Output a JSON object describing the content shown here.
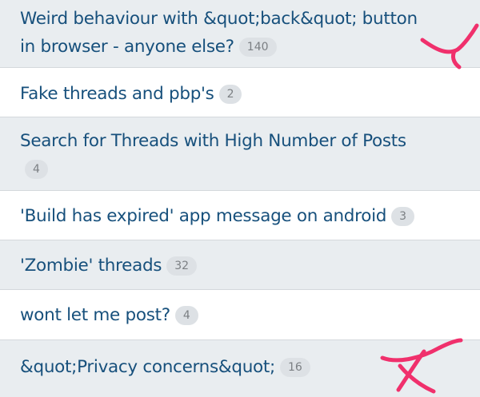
{
  "threads": [
    {
      "title": "Weird behaviour with &quot;back&quot; button in browser - anyone else?",
      "count": "140"
    },
    {
      "title": "Fake threads and pbp's",
      "count": "2"
    },
    {
      "title": "Search for Threads with High Number of Posts",
      "count": "4"
    },
    {
      "title": "'Build has expired' app message on android",
      "count": "3"
    },
    {
      "title": "'Zombie' threads",
      "count": "32"
    },
    {
      "title": "wont let me post?",
      "count": "4"
    },
    {
      "title": "&quot;Privacy concerns&quot;",
      "count": "16"
    }
  ],
  "annotation_color": "#f0306c"
}
